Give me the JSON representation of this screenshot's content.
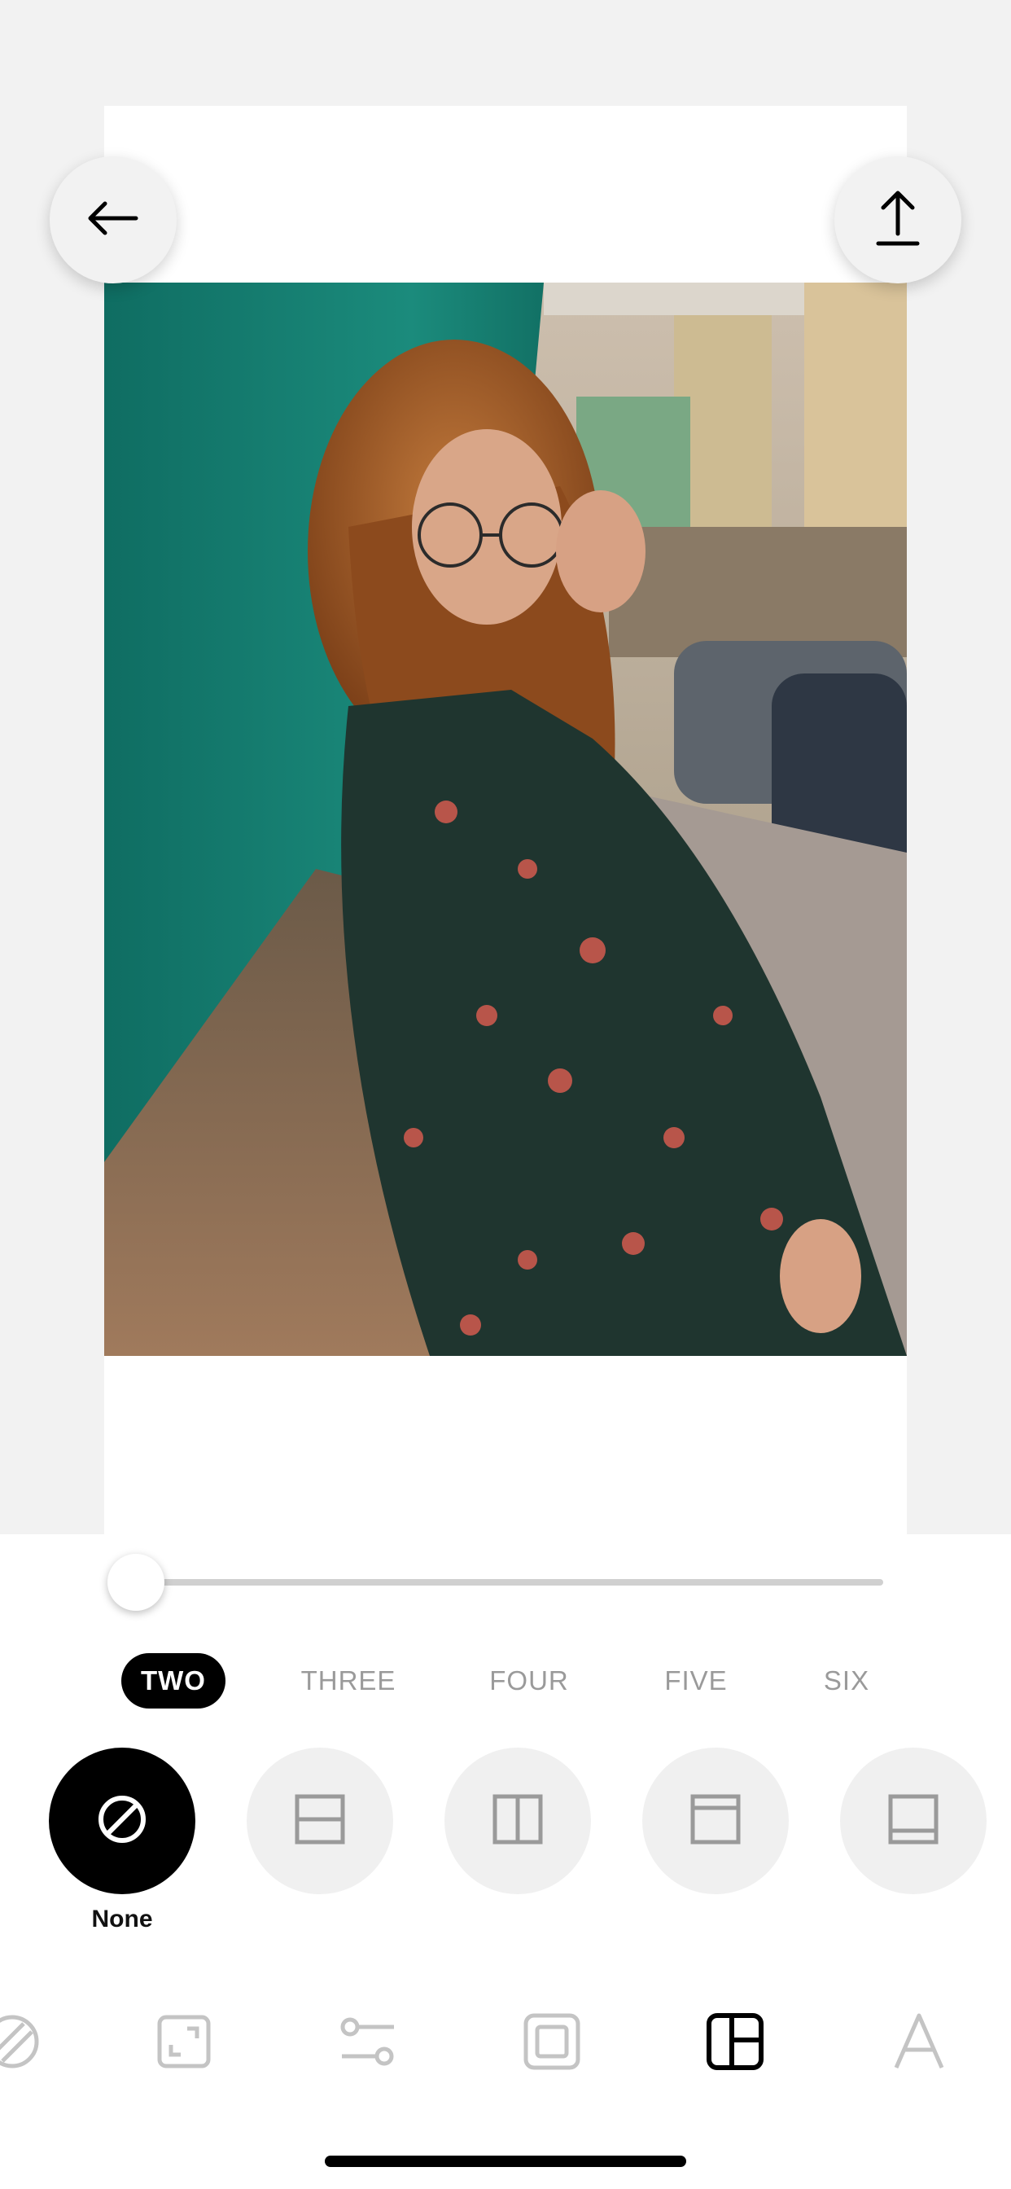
{
  "colors": {
    "accent": "#000000",
    "inactive": "#9a9a9a",
    "background": "#f2f2f2"
  },
  "top_bar": {
    "back_icon": "arrow-left-icon",
    "share_icon": "upload-icon"
  },
  "slider": {
    "value": 0.0
  },
  "count_tabs": [
    {
      "label": "TWO",
      "selected": true
    },
    {
      "label": "THREE",
      "selected": false
    },
    {
      "label": "FOUR",
      "selected": false
    },
    {
      "label": "FIVE",
      "selected": false
    },
    {
      "label": "SIX",
      "selected": false
    }
  ],
  "layout_options": [
    {
      "icon": "none-icon",
      "label": "None",
      "selected": true
    },
    {
      "icon": "split-horizontal-icon",
      "selected": false
    },
    {
      "icon": "split-vertical-icon",
      "selected": false
    },
    {
      "icon": "split-top-icon",
      "selected": false
    },
    {
      "icon": "split-bottom-icon",
      "selected": false
    }
  ],
  "toolbar": [
    {
      "icon": "filter-icon",
      "selected": false
    },
    {
      "icon": "resize-icon",
      "selected": false
    },
    {
      "icon": "adjust-icon",
      "selected": false
    },
    {
      "icon": "border-icon",
      "selected": false
    },
    {
      "icon": "layout-icon",
      "selected": true
    },
    {
      "icon": "text-icon",
      "selected": false
    }
  ]
}
